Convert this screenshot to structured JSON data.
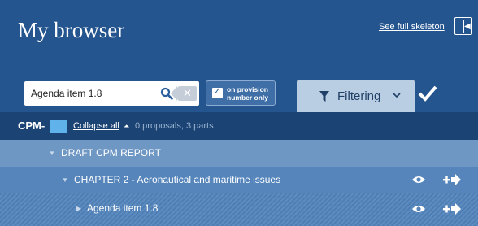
{
  "header": {
    "title": "My browser",
    "see_full_skeleton": "See full skeleton"
  },
  "search": {
    "value": "Agenda item 1.8",
    "placeholder": ""
  },
  "provision_toggle": {
    "label_line1": "on provision",
    "label_line2": "number only",
    "checked": true
  },
  "filter": {
    "label": "Filtering"
  },
  "cpm": {
    "label": "CPM-",
    "collapse_all": "Collapse all",
    "info": "0 proposals, 3 parts"
  },
  "tree": {
    "draft": {
      "label": "DRAFT CPM REPORT"
    },
    "chapter": {
      "label": "CHAPTER 2 - Aeronautical and maritime issues"
    },
    "item": {
      "label": "Agenda item 1.8"
    }
  },
  "colors": {
    "header_bg": "#24558f",
    "cpm_bar_bg": "#1b4474",
    "filter_tab_bg": "#b9cee3",
    "accent": "#5fb2ea"
  }
}
